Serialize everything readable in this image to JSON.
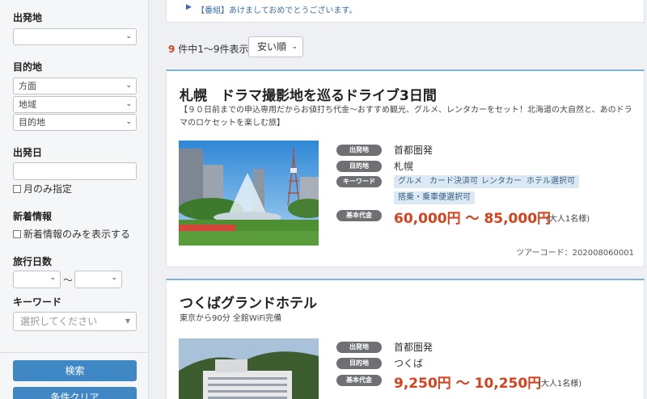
{
  "sidebar": {
    "departure_label": "出発地",
    "departure_value": "",
    "destination_label": "目的地",
    "destination_selects": [
      "方面",
      "地域",
      "目的地"
    ],
    "date_label": "出発日",
    "month_only_label": "月のみ指定",
    "new_label": "新着情報",
    "new_only_label": "新着情報のみを表示する",
    "days_label": "旅行日数",
    "days_separator": "〜",
    "keyword_label": "キーワード",
    "keyword_placeholder": "選択してください",
    "search_button": "検索",
    "clear_button": "条件クリア"
  },
  "notice": {
    "text": "【番組】あけましておめでとうございます。"
  },
  "results": {
    "count_num": "9",
    "count_text": "件中1〜9件表示",
    "sort_value": "安い順"
  },
  "labels": {
    "departure": "出発地",
    "destination": "目的地",
    "keyword": "キーワード",
    "base_price": "基本代金"
  },
  "cards": [
    {
      "title": "札幌　ドラマ撮影地を巡るドライブ3日間",
      "subtitle": "【９０日前までの申込専用だからお値打ち代金〜おすすめ観光、グルメ、レンタカーをセット！北海道の大自然と、あのドラマのロケセットを楽しむ旅】",
      "departure": "首都圏発",
      "destination": "札幌",
      "tags": [
        "グルメ",
        "カード決済可",
        "レンタカー",
        "ホテル選択可",
        "搭乗・乗車便選択可"
      ],
      "price": "60,000円 〜 85,000円",
      "price_note": "(大人1名様)",
      "tour_code": "ツアーコード：202008060001"
    },
    {
      "title": "つくばグランドホテル",
      "subtitle": "東京から90分 全館WiFi完備",
      "departure": "首都圏発",
      "destination": "つくば",
      "price": "9,250円 〜 10,250円",
      "price_note": "(大人1名様)"
    }
  ]
}
